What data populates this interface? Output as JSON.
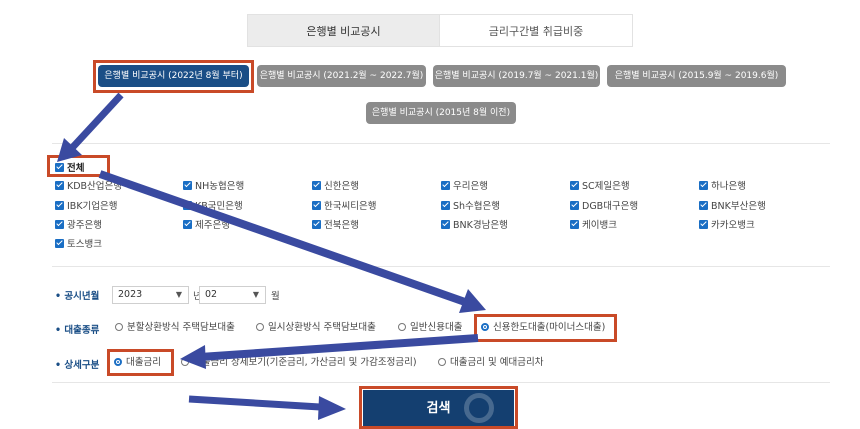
{
  "top_tabs": {
    "active": "은행별 비교공시",
    "inactive": "금리구간별 취급비중"
  },
  "period_buttons": [
    "은행별 비교공시 (2022년 8월 부터)",
    "은행별 비교공시 (2021.2월 ~ 2022.7월)",
    "은행별 비교공시 (2019.7월 ~ 2021.1월)",
    "은행별 비교공시 (2015.9월 ~ 2019.6월)",
    "은행별 비교공시 (2015년 8월 이전)"
  ],
  "banks": {
    "all": "전체",
    "items": [
      "KDB산업은행",
      "NH농협은행",
      "신한은행",
      "우리은행",
      "SC제일은행",
      "하나은행",
      "IBK기업은행",
      "KB국민은행",
      "한국씨티은행",
      "Sh수협은행",
      "DGB대구은행",
      "BNK부산은행",
      "광주은행",
      "제주은행",
      "전북은행",
      "BNK경남은행",
      "케이뱅크",
      "카카오뱅크",
      "토스뱅크"
    ]
  },
  "period": {
    "label": "공시년월",
    "year": "2023",
    "year_unit": "년",
    "month": "02",
    "month_unit": "월"
  },
  "loan_type": {
    "label": "대출종류",
    "options": [
      "분할상환방식 주택담보대출",
      "일시상환방식 주택담보대출",
      "일반신용대출",
      "신용한도대출(마이너스대출)"
    ],
    "selected_index": 3
  },
  "detail": {
    "label": "상세구분",
    "options": [
      "대출금리",
      "대출금리 상세보기(기준금리, 가산금리 및 가감조정금리)",
      "대출금리 및 예대금리차"
    ],
    "selected_index": 0
  },
  "search_label": "검색",
  "colors": {
    "primary": "#1a4e86",
    "button_gray": "#8b8b8b",
    "checkbox": "#1a6ec4",
    "annotation_box": "#c94a28",
    "annotation_arrow": "#3a4aa0"
  }
}
